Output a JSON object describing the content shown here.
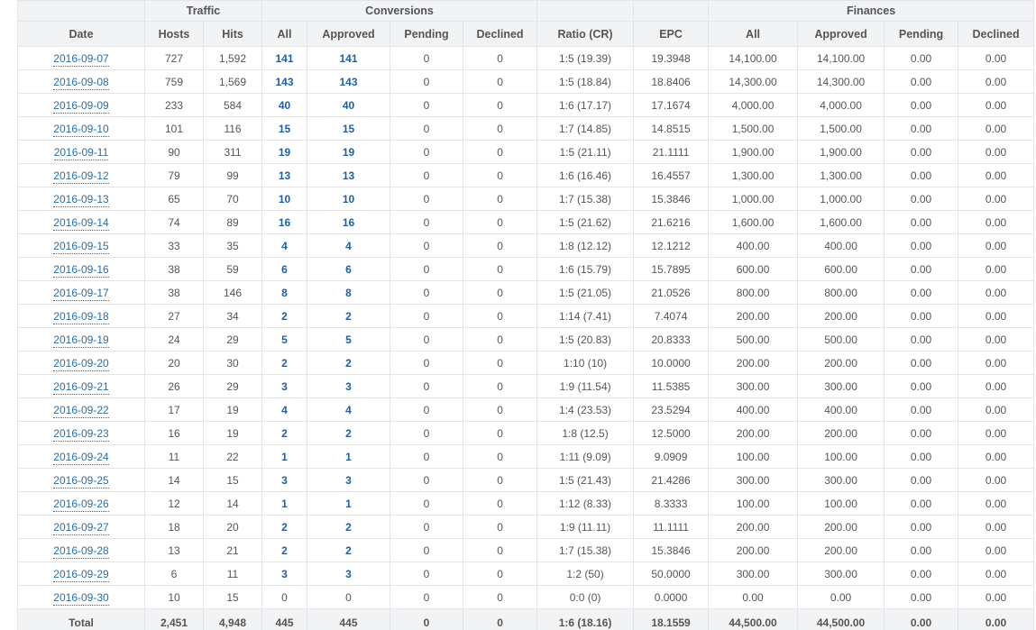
{
  "header": {
    "groups": {
      "traffic": "Traffic",
      "conversions": "Conversions",
      "finances": "Finances"
    },
    "columns": {
      "date": "Date",
      "hosts": "Hosts",
      "hits": "Hits",
      "conv_all": "All",
      "conv_approved": "Approved",
      "conv_pending": "Pending",
      "conv_declined": "Declined",
      "ratio": "Ratio (CR)",
      "epc": "EPC",
      "fin_all": "All",
      "fin_approved": "Approved",
      "fin_pending": "Pending",
      "fin_declined": "Declined"
    }
  },
  "rows": [
    {
      "date": "2016-09-07",
      "hosts": "727",
      "hits": "1,592",
      "conv_all": "141",
      "conv_approved": "141",
      "conv_pending": "0",
      "conv_declined": "0",
      "ratio": "1:5 (19.39)",
      "epc": "19.3948",
      "fin_all": "14,100.00",
      "fin_approved": "14,100.00",
      "fin_pending": "0.00",
      "fin_declined": "0.00"
    },
    {
      "date": "2016-09-08",
      "hosts": "759",
      "hits": "1,569",
      "conv_all": "143",
      "conv_approved": "143",
      "conv_pending": "0",
      "conv_declined": "0",
      "ratio": "1:5 (18.84)",
      "epc": "18.8406",
      "fin_all": "14,300.00",
      "fin_approved": "14,300.00",
      "fin_pending": "0.00",
      "fin_declined": "0.00"
    },
    {
      "date": "2016-09-09",
      "hosts": "233",
      "hits": "584",
      "conv_all": "40",
      "conv_approved": "40",
      "conv_pending": "0",
      "conv_declined": "0",
      "ratio": "1:6 (17.17)",
      "epc": "17.1674",
      "fin_all": "4,000.00",
      "fin_approved": "4,000.00",
      "fin_pending": "0.00",
      "fin_declined": "0.00"
    },
    {
      "date": "2016-09-10",
      "hosts": "101",
      "hits": "116",
      "conv_all": "15",
      "conv_approved": "15",
      "conv_pending": "0",
      "conv_declined": "0",
      "ratio": "1:7 (14.85)",
      "epc": "14.8515",
      "fin_all": "1,500.00",
      "fin_approved": "1,500.00",
      "fin_pending": "0.00",
      "fin_declined": "0.00"
    },
    {
      "date": "2016-09-11",
      "hosts": "90",
      "hits": "311",
      "conv_all": "19",
      "conv_approved": "19",
      "conv_pending": "0",
      "conv_declined": "0",
      "ratio": "1:5 (21.11)",
      "epc": "21.1111",
      "fin_all": "1,900.00",
      "fin_approved": "1,900.00",
      "fin_pending": "0.00",
      "fin_declined": "0.00"
    },
    {
      "date": "2016-09-12",
      "hosts": "79",
      "hits": "99",
      "conv_all": "13",
      "conv_approved": "13",
      "conv_pending": "0",
      "conv_declined": "0",
      "ratio": "1:6 (16.46)",
      "epc": "16.4557",
      "fin_all": "1,300.00",
      "fin_approved": "1,300.00",
      "fin_pending": "0.00",
      "fin_declined": "0.00"
    },
    {
      "date": "2016-09-13",
      "hosts": "65",
      "hits": "70",
      "conv_all": "10",
      "conv_approved": "10",
      "conv_pending": "0",
      "conv_declined": "0",
      "ratio": "1:7 (15.38)",
      "epc": "15.3846",
      "fin_all": "1,000.00",
      "fin_approved": "1,000.00",
      "fin_pending": "0.00",
      "fin_declined": "0.00"
    },
    {
      "date": "2016-09-14",
      "hosts": "74",
      "hits": "89",
      "conv_all": "16",
      "conv_approved": "16",
      "conv_pending": "0",
      "conv_declined": "0",
      "ratio": "1:5 (21.62)",
      "epc": "21.6216",
      "fin_all": "1,600.00",
      "fin_approved": "1,600.00",
      "fin_pending": "0.00",
      "fin_declined": "0.00"
    },
    {
      "date": "2016-09-15",
      "hosts": "33",
      "hits": "35",
      "conv_all": "4",
      "conv_approved": "4",
      "conv_pending": "0",
      "conv_declined": "0",
      "ratio": "1:8 (12.12)",
      "epc": "12.1212",
      "fin_all": "400.00",
      "fin_approved": "400.00",
      "fin_pending": "0.00",
      "fin_declined": "0.00"
    },
    {
      "date": "2016-09-16",
      "hosts": "38",
      "hits": "59",
      "conv_all": "6",
      "conv_approved": "6",
      "conv_pending": "0",
      "conv_declined": "0",
      "ratio": "1:6 (15.79)",
      "epc": "15.7895",
      "fin_all": "600.00",
      "fin_approved": "600.00",
      "fin_pending": "0.00",
      "fin_declined": "0.00"
    },
    {
      "date": "2016-09-17",
      "hosts": "38",
      "hits": "146",
      "conv_all": "8",
      "conv_approved": "8",
      "conv_pending": "0",
      "conv_declined": "0",
      "ratio": "1:5 (21.05)",
      "epc": "21.0526",
      "fin_all": "800.00",
      "fin_approved": "800.00",
      "fin_pending": "0.00",
      "fin_declined": "0.00"
    },
    {
      "date": "2016-09-18",
      "hosts": "27",
      "hits": "34",
      "conv_all": "2",
      "conv_approved": "2",
      "conv_pending": "0",
      "conv_declined": "0",
      "ratio": "1:14 (7.41)",
      "epc": "7.4074",
      "fin_all": "200.00",
      "fin_approved": "200.00",
      "fin_pending": "0.00",
      "fin_declined": "0.00"
    },
    {
      "date": "2016-09-19",
      "hosts": "24",
      "hits": "29",
      "conv_all": "5",
      "conv_approved": "5",
      "conv_pending": "0",
      "conv_declined": "0",
      "ratio": "1:5 (20.83)",
      "epc": "20.8333",
      "fin_all": "500.00",
      "fin_approved": "500.00",
      "fin_pending": "0.00",
      "fin_declined": "0.00"
    },
    {
      "date": "2016-09-20",
      "hosts": "20",
      "hits": "30",
      "conv_all": "2",
      "conv_approved": "2",
      "conv_pending": "0",
      "conv_declined": "0",
      "ratio": "1:10 (10)",
      "epc": "10.0000",
      "fin_all": "200.00",
      "fin_approved": "200.00",
      "fin_pending": "0.00",
      "fin_declined": "0.00"
    },
    {
      "date": "2016-09-21",
      "hosts": "26",
      "hits": "29",
      "conv_all": "3",
      "conv_approved": "3",
      "conv_pending": "0",
      "conv_declined": "0",
      "ratio": "1:9 (11.54)",
      "epc": "11.5385",
      "fin_all": "300.00",
      "fin_approved": "300.00",
      "fin_pending": "0.00",
      "fin_declined": "0.00"
    },
    {
      "date": "2016-09-22",
      "hosts": "17",
      "hits": "19",
      "conv_all": "4",
      "conv_approved": "4",
      "conv_pending": "0",
      "conv_declined": "0",
      "ratio": "1:4 (23.53)",
      "epc": "23.5294",
      "fin_all": "400.00",
      "fin_approved": "400.00",
      "fin_pending": "0.00",
      "fin_declined": "0.00"
    },
    {
      "date": "2016-09-23",
      "hosts": "16",
      "hits": "19",
      "conv_all": "2",
      "conv_approved": "2",
      "conv_pending": "0",
      "conv_declined": "0",
      "ratio": "1:8 (12.5)",
      "epc": "12.5000",
      "fin_all": "200.00",
      "fin_approved": "200.00",
      "fin_pending": "0.00",
      "fin_declined": "0.00"
    },
    {
      "date": "2016-09-24",
      "hosts": "11",
      "hits": "22",
      "conv_all": "1",
      "conv_approved": "1",
      "conv_pending": "0",
      "conv_declined": "0",
      "ratio": "1:11 (9.09)",
      "epc": "9.0909",
      "fin_all": "100.00",
      "fin_approved": "100.00",
      "fin_pending": "0.00",
      "fin_declined": "0.00"
    },
    {
      "date": "2016-09-25",
      "hosts": "14",
      "hits": "15",
      "conv_all": "3",
      "conv_approved": "3",
      "conv_pending": "0",
      "conv_declined": "0",
      "ratio": "1:5 (21.43)",
      "epc": "21.4286",
      "fin_all": "300.00",
      "fin_approved": "300.00",
      "fin_pending": "0.00",
      "fin_declined": "0.00"
    },
    {
      "date": "2016-09-26",
      "hosts": "12",
      "hits": "14",
      "conv_all": "1",
      "conv_approved": "1",
      "conv_pending": "0",
      "conv_declined": "0",
      "ratio": "1:12 (8.33)",
      "epc": "8.3333",
      "fin_all": "100.00",
      "fin_approved": "100.00",
      "fin_pending": "0.00",
      "fin_declined": "0.00"
    },
    {
      "date": "2016-09-27",
      "hosts": "18",
      "hits": "20",
      "conv_all": "2",
      "conv_approved": "2",
      "conv_pending": "0",
      "conv_declined": "0",
      "ratio": "1:9 (11.11)",
      "epc": "11.1111",
      "fin_all": "200.00",
      "fin_approved": "200.00",
      "fin_pending": "0.00",
      "fin_declined": "0.00"
    },
    {
      "date": "2016-09-28",
      "hosts": "13",
      "hits": "21",
      "conv_all": "2",
      "conv_approved": "2",
      "conv_pending": "0",
      "conv_declined": "0",
      "ratio": "1:7 (15.38)",
      "epc": "15.3846",
      "fin_all": "200.00",
      "fin_approved": "200.00",
      "fin_pending": "0.00",
      "fin_declined": "0.00"
    },
    {
      "date": "2016-09-29",
      "hosts": "6",
      "hits": "11",
      "conv_all": "3",
      "conv_approved": "3",
      "conv_pending": "0",
      "conv_declined": "0",
      "ratio": "1:2 (50)",
      "epc": "50.0000",
      "fin_all": "300.00",
      "fin_approved": "300.00",
      "fin_pending": "0.00",
      "fin_declined": "0.00"
    },
    {
      "date": "2016-09-30",
      "hosts": "10",
      "hits": "15",
      "conv_all": "0",
      "conv_approved": "0",
      "conv_pending": "0",
      "conv_declined": "0",
      "ratio": "0:0 (0)",
      "epc": "0.0000",
      "fin_all": "0.00",
      "fin_approved": "0.00",
      "fin_pending": "0.00",
      "fin_declined": "0.00"
    }
  ],
  "total": {
    "label": "Total",
    "hosts": "2,451",
    "hits": "4,948",
    "conv_all": "445",
    "conv_approved": "445",
    "conv_pending": "0",
    "conv_declined": "0",
    "ratio": "1:6 (18.16)",
    "epc": "18.1559",
    "fin_all": "44,500.00",
    "fin_approved": "44,500.00",
    "fin_pending": "0.00",
    "fin_declined": "0.00"
  },
  "colors": {
    "link": "#2a6ea6",
    "conversion_link": "#1f5fa6",
    "header_bg": "#f1f3f5",
    "border": "#e2e6ea",
    "text": "#555555"
  }
}
